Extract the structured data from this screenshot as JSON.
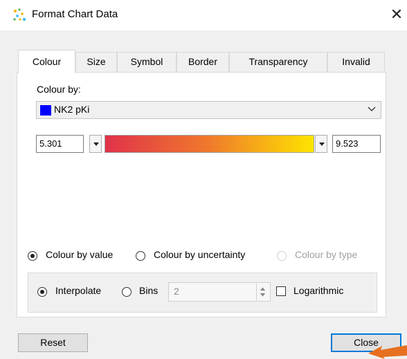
{
  "window": {
    "title": "Format Chart Data",
    "close_glyph": "✕"
  },
  "tabs": [
    {
      "label": "Colour",
      "active": true
    },
    {
      "label": "Size"
    },
    {
      "label": "Symbol"
    },
    {
      "label": "Border"
    },
    {
      "label": "Transparency"
    },
    {
      "label": "Invalid"
    }
  ],
  "colour_by": {
    "label": "Colour by:",
    "selected": "NK2 pKi",
    "swatch_color": "#0000ff",
    "min_value": "5.301",
    "max_value": "9.523",
    "gradient": [
      "#e0324a",
      "#f07a2c",
      "#fde400"
    ]
  },
  "mode": {
    "by_value": "Colour by value",
    "by_uncertainty": "Colour by uncertainty",
    "by_type": "Colour by type",
    "selected": "by_value"
  },
  "scale": {
    "interpolate": "Interpolate",
    "bins": "Bins",
    "bins_value": "2",
    "logarithmic": "Logarithmic",
    "selected": "interpolate"
  },
  "buttons": {
    "reset": "Reset",
    "close": "Close"
  }
}
